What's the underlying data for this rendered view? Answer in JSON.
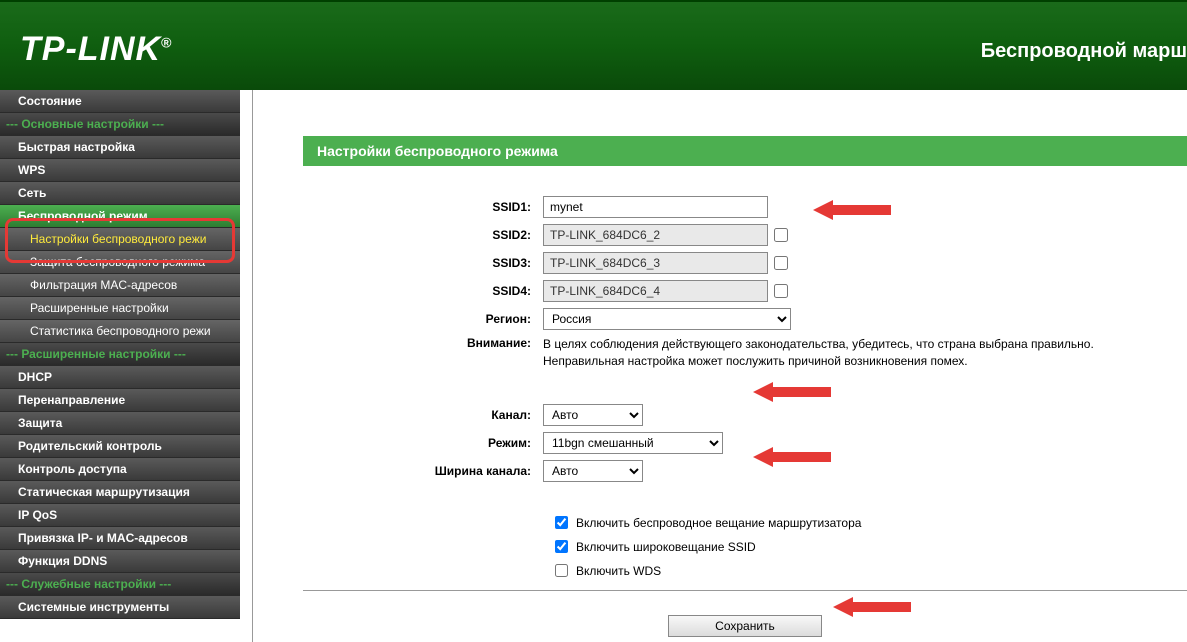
{
  "header": {
    "logo": "TP-LINK",
    "title": "Беспроводной марш"
  },
  "sidebar": {
    "items": [
      {
        "label": "Состояние",
        "type": "item"
      },
      {
        "label": "--- Основные настройки ---",
        "type": "section"
      },
      {
        "label": "Быстрая настройка",
        "type": "item"
      },
      {
        "label": "WPS",
        "type": "item"
      },
      {
        "label": "Сеть",
        "type": "item"
      },
      {
        "label": "Беспроводной режим",
        "type": "active"
      },
      {
        "label": "Настройки беспроводного режи",
        "type": "sub-active"
      },
      {
        "label": "Защита беспроводного режима",
        "type": "sub"
      },
      {
        "label": "Фильтрация MAC-адресов",
        "type": "sub"
      },
      {
        "label": "Расширенные настройки",
        "type": "sub"
      },
      {
        "label": "Статистика беспроводного режи",
        "type": "sub"
      },
      {
        "label": "--- Расширенные настройки ---",
        "type": "section"
      },
      {
        "label": "DHCP",
        "type": "item"
      },
      {
        "label": "Перенаправление",
        "type": "item"
      },
      {
        "label": "Защита",
        "type": "item"
      },
      {
        "label": "Родительский контроль",
        "type": "item"
      },
      {
        "label": "Контроль доступа",
        "type": "item"
      },
      {
        "label": "Статическая маршрутизация",
        "type": "item"
      },
      {
        "label": "IP QoS",
        "type": "item"
      },
      {
        "label": "Привязка IP- и MAC-адресов",
        "type": "item"
      },
      {
        "label": "Функция DDNS",
        "type": "item"
      },
      {
        "label": "--- Служебные настройки ---",
        "type": "section"
      },
      {
        "label": "Системные инструменты",
        "type": "item"
      }
    ]
  },
  "panel": {
    "title": "Настройки беспроводного режима"
  },
  "form": {
    "ssid1_label": "SSID1:",
    "ssid1_value": "mynet",
    "ssid2_label": "SSID2:",
    "ssid2_value": "TP-LINK_684DC6_2",
    "ssid3_label": "SSID3:",
    "ssid3_value": "TP-LINK_684DC6_3",
    "ssid4_label": "SSID4:",
    "ssid4_value": "TP-LINK_684DC6_4",
    "region_label": "Регион:",
    "region_value": "Россия",
    "warning_label": "Внимание:",
    "warning_text": "В целях соблюдения действующего законодательства, убедитесь, что страна выбрана правильно. Неправильная настройка может послужить причиной возникновения помех.",
    "channel_label": "Канал:",
    "channel_value": "Авто",
    "mode_label": "Режим:",
    "mode_value": "11bgn смешанный",
    "width_label": "Ширина канала:",
    "width_value": "Авто",
    "cb_wireless": "Включить беспроводное вещание маршрутизатора",
    "cb_ssid": "Включить широковещание SSID",
    "cb_wds": "Включить WDS",
    "save": "Сохранить"
  }
}
